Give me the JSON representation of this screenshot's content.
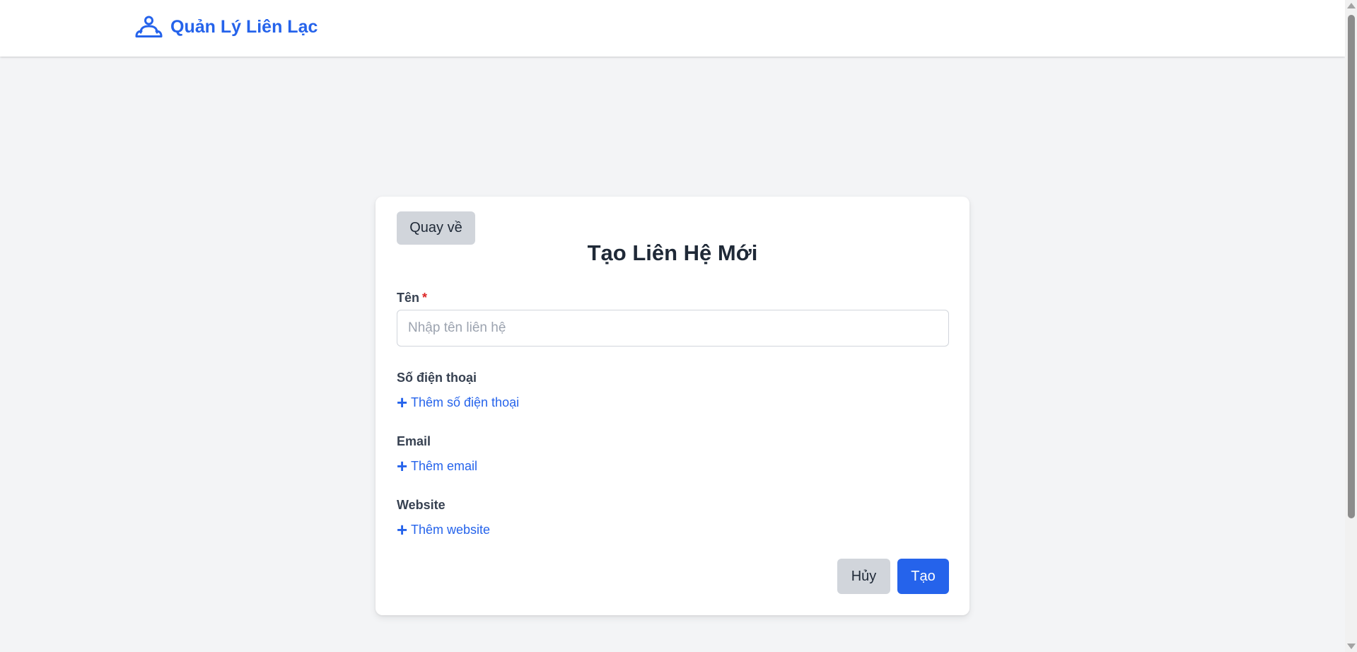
{
  "header": {
    "brand_icon": "contacts-icon",
    "app_title": "Quản Lý Liên Lạc",
    "brand_color": "#2563eb"
  },
  "form": {
    "back_label": "Quay về",
    "title": "Tạo Liên Hệ Mới",
    "name": {
      "label": "Tên",
      "required_mark": "*",
      "placeholder": "Nhập tên liên hệ",
      "value": ""
    },
    "phone": {
      "label": "Số điện thoại",
      "add_label": "Thêm số điện thoại",
      "icon": "plus-icon"
    },
    "email": {
      "label": "Email",
      "add_label": "Thêm email",
      "icon": "plus-icon"
    },
    "website": {
      "label": "Website",
      "add_label": "Thêm website",
      "icon": "plus-icon"
    },
    "cancel_label": "Hủy",
    "submit_label": "Tạo"
  },
  "colors": {
    "accent": "#2563eb",
    "required": "#dc2626",
    "neutral_button": "#d1d5db",
    "page_background": "#f3f4f6"
  }
}
